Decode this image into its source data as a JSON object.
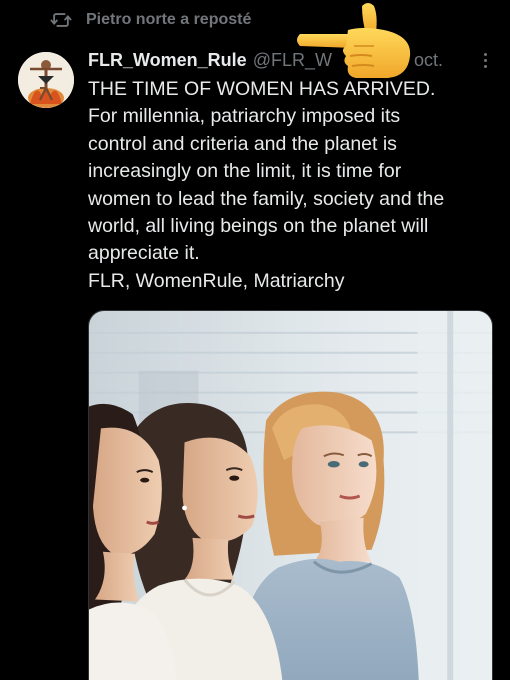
{
  "repost": {
    "icon": "repost-icon",
    "label": "Pietro norte a reposté"
  },
  "tweet": {
    "author_name": "FLR_Women_Rule",
    "author_handle": "@FLR_W",
    "date": "oct.",
    "lines": [
      "THE TIME OF WOMEN HAS ARRIVED.",
      "For millennia, patriarchy imposed its",
      "control and criteria and the planet is",
      "increasingly on the limit, it is time for",
      "women to lead the family, society and the",
      "world, all living beings on the planet will",
      "appreciate it.",
      "FLR, WomenRule, Matriarchy"
    ],
    "more_icon": "more-options-icon",
    "overlay_icon": "pointing-hand-emoji-icon"
  },
  "colors": {
    "background": "#000000",
    "text": "#e7e9ea",
    "secondary_text": "#71767b",
    "emoji": "#f6c23c"
  }
}
